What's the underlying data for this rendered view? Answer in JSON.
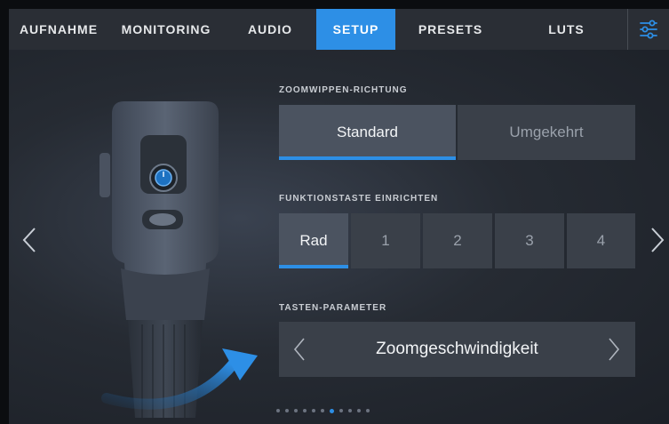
{
  "tabs": [
    {
      "label": "AUFNAHME"
    },
    {
      "label": "MONITORING"
    },
    {
      "label": "AUDIO"
    },
    {
      "label": "SETUP",
      "active": true
    },
    {
      "label": "PRESETS"
    },
    {
      "label": "LUTS"
    }
  ],
  "settings_icon": "sliders-icon",
  "zoom_direction": {
    "label": "ZOOMWIPPEN-RICHTUNG",
    "options": [
      "Standard",
      "Umgekehrt"
    ],
    "selected": "Standard"
  },
  "function_button": {
    "label": "FUNKTIONSTASTE EINRICHTEN",
    "options": [
      "Rad",
      "1",
      "2",
      "3",
      "4"
    ],
    "selected": "Rad"
  },
  "button_parameter": {
    "label": "TASTEN-PARAMETER",
    "value": "Zoomgeschwindigkeit"
  },
  "pagination": {
    "total": 11,
    "current_index": 6
  },
  "colors": {
    "accent": "#2d8fe6",
    "tab_bar": "#2a2e35",
    "button": "#3a4049",
    "button_selected": "#4b5360"
  }
}
